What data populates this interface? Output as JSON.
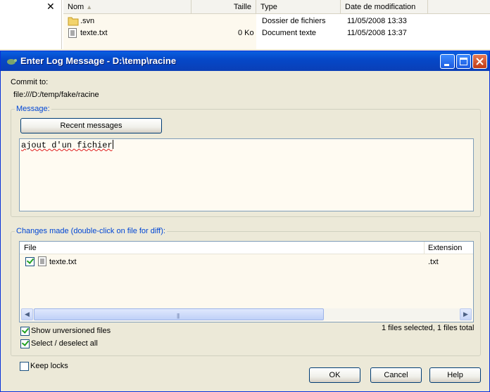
{
  "explorer": {
    "close_glyph": "✕",
    "columns": [
      "Nom",
      "Taille",
      "Type",
      "Date de modification"
    ],
    "rows": [
      {
        "name": ".svn",
        "size": "",
        "type": "Dossier de fichiers",
        "date": "11/05/2008 13:33",
        "icon": "folder-icon"
      },
      {
        "name": "texte.txt",
        "size": "0 Ko",
        "type": "Document texte",
        "date": "11/05/2008 13:37",
        "icon": "text-file-icon"
      }
    ]
  },
  "dialog": {
    "title": "Enter Log Message - D:\\temp\\racine",
    "commit_to_label": "Commit to:",
    "commit_url": "file:///D:/temp/fake/racine",
    "message_group": "Message:",
    "recent_messages_button": "Recent messages",
    "message_text": "ajout d'un fichier",
    "changes_group": "Changes made (double-click on file for diff):",
    "list_columns": [
      "File",
      "Extension"
    ],
    "files": [
      {
        "name": "texte.txt",
        "extension": ".txt",
        "checked": true
      }
    ],
    "show_unversioned": "Show unversioned files",
    "select_all": "Select / deselect all",
    "status_text": "1 files selected, 1 files total",
    "keep_locks": "Keep locks",
    "ok_button": "OK",
    "cancel_button": "Cancel",
    "help_button": "Help",
    "scroll_grip": "|||"
  },
  "colors": {
    "titlebar": "#0548c8",
    "group_title": "#0046d5",
    "list_bg": "#fdf9ee"
  }
}
